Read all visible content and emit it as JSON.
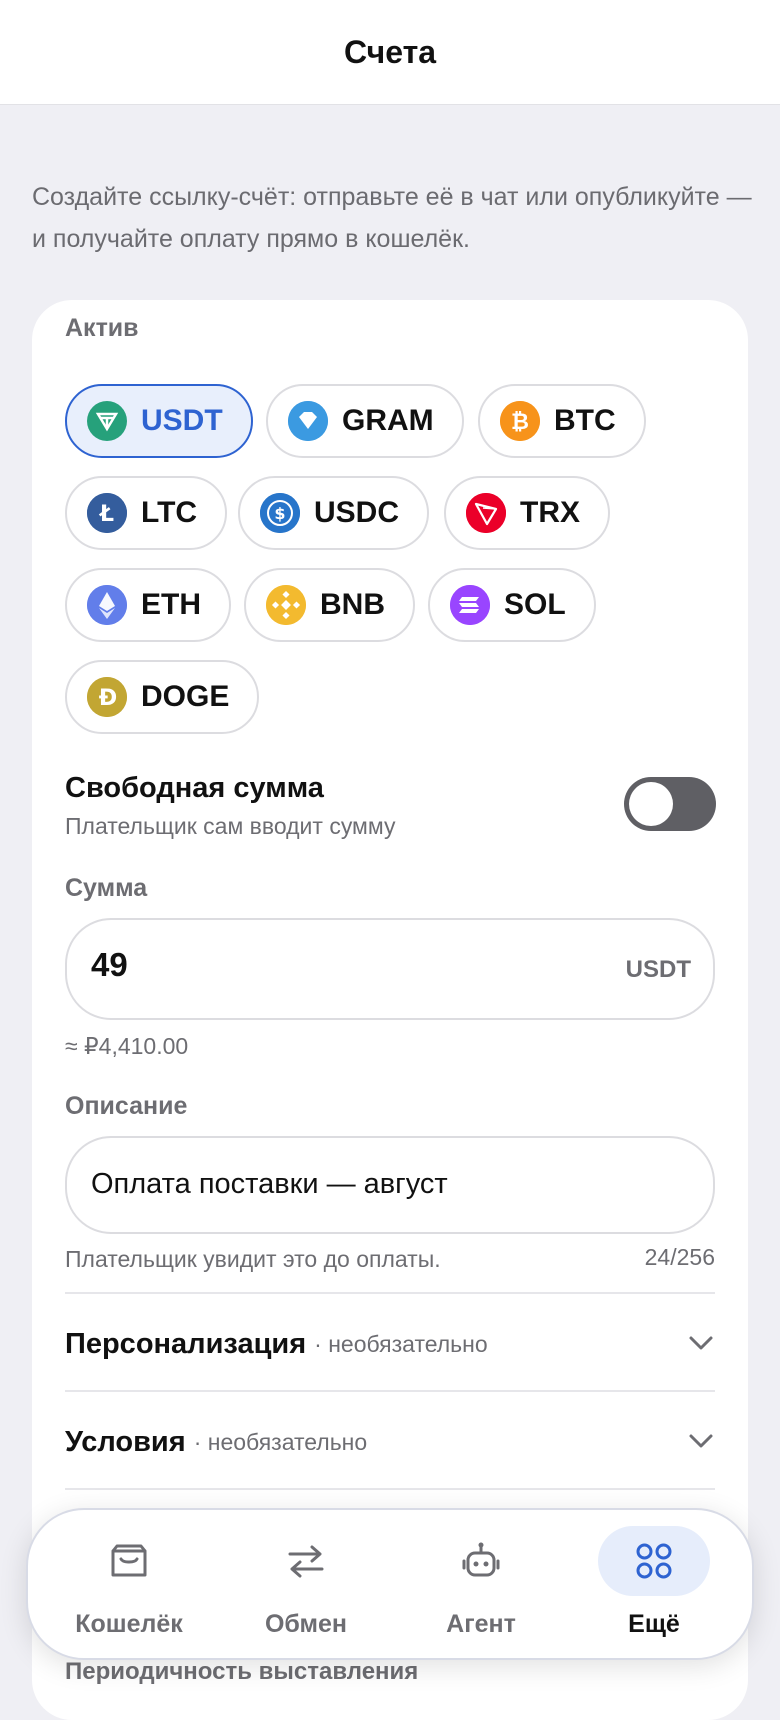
{
  "header": {
    "title": "Счета"
  },
  "intro": "Создайте ссылку-счёт: отправьте её в чат или опубликуйте — и получайте оплату прямо в кошелёк.",
  "asset": {
    "label": "Актив",
    "options": [
      {
        "symbol": "USDT",
        "color": "#26a17b",
        "selected": true,
        "icon": "tether-icon"
      },
      {
        "symbol": "GRAM",
        "color": "#3b9ae1",
        "selected": false,
        "icon": "gram-icon"
      },
      {
        "symbol": "BTC",
        "color": "#f7931a",
        "selected": false,
        "icon": "bitcoin-icon"
      },
      {
        "symbol": "LTC",
        "color": "#345d9d",
        "selected": false,
        "icon": "litecoin-icon"
      },
      {
        "symbol": "USDC",
        "color": "#2775ca",
        "selected": false,
        "icon": "usdc-icon"
      },
      {
        "symbol": "TRX",
        "color": "#eb0029",
        "selected": false,
        "icon": "tron-icon"
      },
      {
        "symbol": "ETH",
        "color": "#627eea",
        "selected": false,
        "icon": "ethereum-icon"
      },
      {
        "symbol": "BNB",
        "color": "#f3ba2f",
        "selected": false,
        "icon": "bnb-icon"
      },
      {
        "symbol": "SOL",
        "color": "#9945ff",
        "selected": false,
        "icon": "solana-icon"
      },
      {
        "symbol": "DOGE",
        "color": "#c2a633",
        "selected": false,
        "icon": "dogecoin-icon"
      }
    ]
  },
  "free_amount": {
    "title": "Свободная сумма",
    "subtitle": "Плательщик сам вводит сумму",
    "enabled": false
  },
  "amount": {
    "label": "Сумма",
    "value": "49",
    "currency": "USDT",
    "approx": "≈ ₽4,410.00"
  },
  "description": {
    "label": "Описание",
    "value": "Оплата поставки — август",
    "helper": "Плательщик увидит это до оплаты.",
    "counter": "24/256"
  },
  "sections": [
    {
      "title": "Персонализация",
      "optional": "· необязательно"
    },
    {
      "title": "Условия",
      "optional": "· необязательно"
    }
  ],
  "partial_section": "Периодичность выставления",
  "bottom_nav": [
    {
      "label": "Кошелёк",
      "icon": "wallet-icon",
      "active": false
    },
    {
      "label": "Обмен",
      "icon": "exchange-icon",
      "active": false
    },
    {
      "label": "Агент",
      "icon": "robot-icon",
      "active": false
    },
    {
      "label": "Ещё",
      "icon": "grid-icon",
      "active": true
    }
  ],
  "colors": {
    "accent": "#2e63d1",
    "toggle_off": "#5f5f64",
    "background": "#efeff4"
  }
}
